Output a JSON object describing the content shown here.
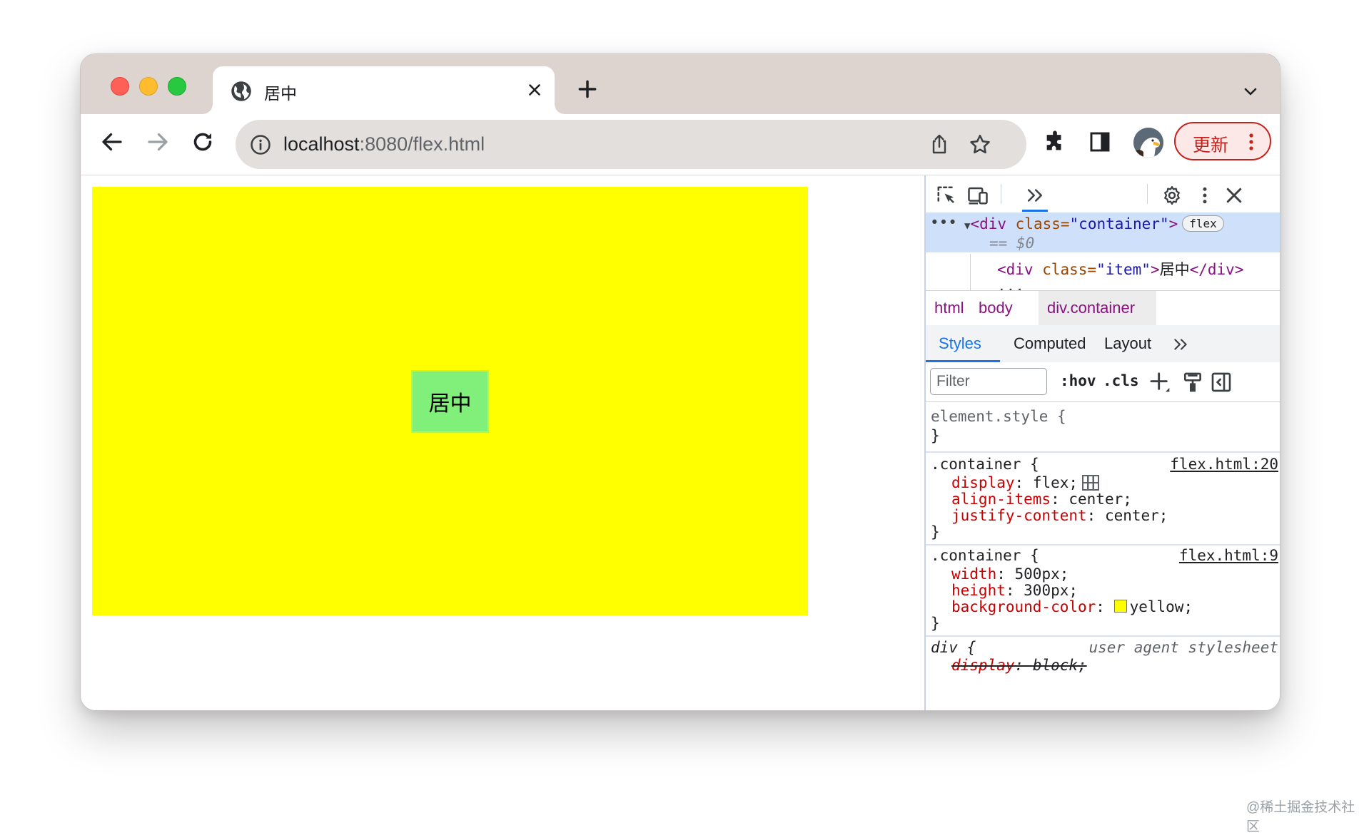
{
  "tab": {
    "title": "居中"
  },
  "omnibox": {
    "host": "localhost",
    "rest": ":8080/flex.html"
  },
  "toolbar": {
    "update_label": "更新"
  },
  "page": {
    "item_text": "居中"
  },
  "devtools": {
    "dom": {
      "container_open_tag": "<div",
      "container_attr_name": " class=",
      "container_attr_value": "\"container\"",
      "container_close_bracket": ">",
      "flex_badge": "flex",
      "selected_marker": "== $0",
      "item_open": "<div",
      "item_attr_name": " class=",
      "item_attr_value": "\"item\"",
      "item_gt": ">",
      "item_text": "居中",
      "item_close": "</div>",
      "more": "..."
    },
    "breadcrumbs": [
      "html",
      "body",
      "div.container"
    ],
    "subtabs": [
      "Styles",
      "Computed",
      "Layout"
    ],
    "filter_placeholder": "Filter",
    "hov_label": ":hov",
    "cls_label": ".cls",
    "rules": {
      "element_style": {
        "selector": "element.style {",
        "close": "}"
      },
      "container1": {
        "selector": ".container {",
        "source": "flex.html:20",
        "decls": [
          {
            "prop": "display",
            "value": "flex;"
          },
          {
            "prop": "align-items",
            "value": "center;"
          },
          {
            "prop": "justify-content",
            "value": "center;"
          }
        ],
        "close": "}"
      },
      "container2": {
        "selector": ".container {",
        "source": "flex.html:9",
        "decls": [
          {
            "prop": "width",
            "value": "500px;"
          },
          {
            "prop": "height",
            "value": "300px;"
          },
          {
            "prop": "background-color",
            "value": "yellow;"
          }
        ],
        "close": "}"
      },
      "div_ua": {
        "selector": "div {",
        "source": "user agent stylesheet",
        "decl_prop": "display",
        "decl_value": "block;"
      }
    }
  },
  "colors": {
    "container_bg": "#ffff00",
    "item_bg": "#80f07a",
    "accent": "#1a73e8",
    "update_red": "#c5221f"
  },
  "icons": {
    "tab_favicon": "globe-icon",
    "tab_close": "close-icon",
    "new_tab": "plus-icon",
    "tab_search": "chevron-down-icon",
    "back": "back-arrow-icon",
    "forward": "forward-arrow-icon",
    "reload": "reload-icon",
    "site_info": "info-icon",
    "share": "share-icon",
    "bookmark": "star-icon",
    "extensions": "puzzle-icon",
    "side_panel": "side-panel-icon",
    "profile": "eagle-avatar",
    "menu": "kebab-icon"
  },
  "watermark": "@稀土掘金技术社区"
}
